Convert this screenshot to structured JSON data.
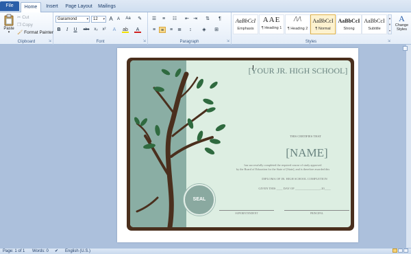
{
  "tabs": {
    "file": "File",
    "home": "Home",
    "insert": "Insert",
    "layout": "Page Layout",
    "mailings": "Mailings"
  },
  "clipboard": {
    "paste": "Paste",
    "cut": "Cut",
    "copy": "Copy",
    "format_painter": "Format Painter",
    "group": "Clipboard"
  },
  "font": {
    "name": "Garamond",
    "size": "12",
    "group": "Font",
    "bold": "B",
    "italic": "I",
    "underline": "U",
    "strike": "abc",
    "sub": "x₂",
    "sup": "x²",
    "grow": "A",
    "shrink": "A",
    "clear": "Aa",
    "color": "A"
  },
  "paragraph": {
    "group": "Paragraph",
    "pilcrow": "¶"
  },
  "styles": {
    "group": "Styles",
    "items": [
      {
        "preview": "AaBbCcI",
        "name": "Emphasis"
      },
      {
        "preview": "AAE",
        "name": "¶ Heading 1"
      },
      {
        "preview": "/\\/\\",
        "name": "¶ Heading 2"
      },
      {
        "preview": "AaBbCcI",
        "name": "¶ Normal"
      },
      {
        "preview": "AaBbCcI",
        "name": "Strong"
      },
      {
        "preview": "AaBbCcI",
        "name": "Subtitle"
      }
    ],
    "change_styles": "Change Styles"
  },
  "certificate": {
    "school": "[YOUR JR. HIGH SCHOOL]",
    "certifies": "THIS CERTIFIES THAT",
    "name": "[NAME]",
    "body_line1": "has successfully completed the required course of study approved",
    "body_line2": "by the Board of Education for the State of [State], and is therefore awarded this",
    "diploma": "DIPLOMA OF JR. HIGH SCHOOL COMPLETION",
    "given": "GIVEN THIS ____ DAY OF ________________, 20____",
    "seal": "SEAL",
    "superintendent": "SUPERINTENDENT",
    "principal": "PRINCIPAL"
  },
  "status": {
    "page": "Page: 1 of 1",
    "words": "Words: 0",
    "language": "English (U.S.)"
  },
  "colors": {
    "ribbon_accent": "#2a5ea8",
    "doc_background": "#acc0dc",
    "frame": "#4a2f1d",
    "certificate": "#ddeee2",
    "panel": "#8aaea4",
    "leaf": "#2f6a3f"
  }
}
